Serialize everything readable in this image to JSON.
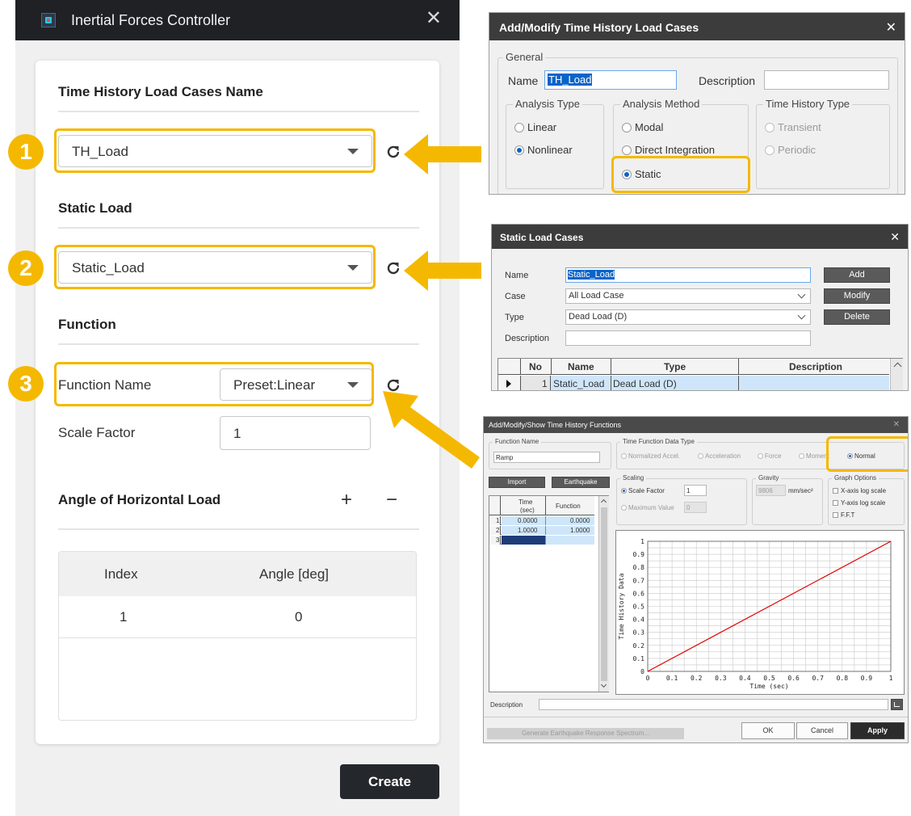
{
  "inertial_panel": {
    "title": "Inertial Forces Controller",
    "close": "✕",
    "th_section": "Time History Load Cases Name",
    "th_value": "TH_Load",
    "static_section": "Static Load",
    "static_value": "Static_Load",
    "function_section": "Function",
    "function_name_label": "Function Name",
    "function_value": "Preset:Linear",
    "scale_label": "Scale Factor",
    "scale_value": "1",
    "angle_section": "Angle of Horizontal Load",
    "plus": "+",
    "minus": "−",
    "table_headers": [
      "Index",
      "Angle [deg]"
    ],
    "table_rows": [
      [
        "1",
        "0"
      ]
    ],
    "create_label": "Create",
    "badges": [
      "1",
      "2",
      "3"
    ]
  },
  "th_dialog": {
    "title": "Add/Modify Time History Load Cases",
    "close": "✕",
    "general": "General",
    "name_label": "Name",
    "name_value": "TH_Load",
    "description_label": "Description",
    "analysis_type": "Analysis Type",
    "linear": "Linear",
    "nonlinear": "Nonlinear",
    "analysis_method": "Analysis Method",
    "modal": "Modal",
    "direct": "Direct Integration",
    "static": "Static",
    "th_type": "Time History Type",
    "transient": "Transient",
    "periodic": "Periodic"
  },
  "slc_dialog": {
    "title": "Static Load Cases",
    "close": "✕",
    "name_label": "Name",
    "name_value": "Static_Load",
    "case_label": "Case",
    "case_value": "All Load Case",
    "type_label": "Type",
    "type_value": "Dead Load (D)",
    "desc_label": "Description",
    "add": "Add",
    "modify": "Modify",
    "delete": "Delete",
    "headers": [
      "No",
      "Name",
      "Type",
      "Description"
    ],
    "row": {
      "no": "1",
      "name": "Static_Load",
      "type": "Dead Load (D)",
      "desc": ""
    }
  },
  "thf_dialog": {
    "title": "Add/Modify/Show Time History Functions",
    "close": "✕",
    "function_name": "Function Name",
    "function_value": "Ramp",
    "data_type": "Time Function Data Type",
    "opt_norm_accel": "Normalized Accel.",
    "opt_accel": "Acceleration",
    "opt_force": "Force",
    "opt_moment": "Moment",
    "opt_normal": "Normal",
    "import": "Import",
    "earthquake": "Earthquake",
    "col_time": "Time",
    "col_time_unit": "(sec)",
    "col_function": "Function",
    "rows": [
      {
        "idx": "1",
        "time": "0.0000",
        "fn": "0.0000"
      },
      {
        "idx": "2",
        "time": "1.0000",
        "fn": "1.0000"
      },
      {
        "idx": "3",
        "time": "",
        "fn": ""
      }
    ],
    "scaling": "Scaling",
    "scale_factor": "Scale Factor",
    "scale_value": "1",
    "maximum_value": "Maximum Value",
    "max_value": "0",
    "gravity": "Gravity",
    "gravity_value": "9806",
    "gravity_unit": "mm/sec²",
    "graph_options": "Graph Options",
    "xlog": "X-axis log scale",
    "ylog": "Y-axis log scale",
    "fft": "F.F.T",
    "description": "Description",
    "generate": "Generate Earthquake Response Spectrum...",
    "ok": "OK",
    "cancel": "Cancel",
    "apply": "Apply",
    "colors": {
      "line": "#e00000"
    }
  },
  "chart_data": {
    "type": "line",
    "xlabel": "Time (sec)",
    "ylabel": "Time History Data",
    "xlim": [
      0,
      1
    ],
    "ylim": [
      0,
      1
    ],
    "grid": true,
    "x_ticks": [
      "0",
      "0.1",
      "0.2",
      "0.3",
      "0.4",
      "0.5",
      "0.6",
      "0.7",
      "0.8",
      "0.9",
      "1"
    ],
    "y_ticks": [
      "0",
      "0.1",
      "0.2",
      "0.3",
      "0.4",
      "0.5",
      "0.6",
      "0.7",
      "0.8",
      "0.9",
      "1"
    ],
    "series": [
      {
        "x": [
          0,
          1
        ],
        "y": [
          0,
          1
        ]
      }
    ]
  }
}
